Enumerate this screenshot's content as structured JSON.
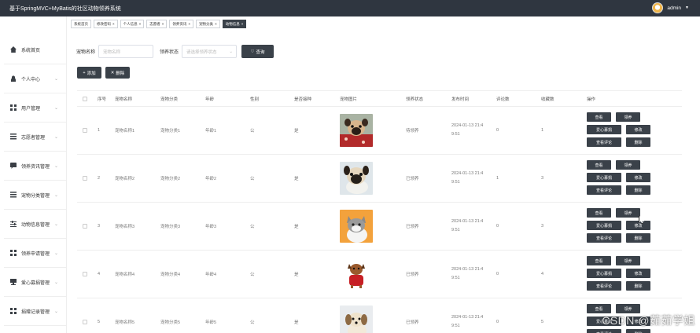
{
  "app": {
    "title": "基于SpringMVC+MyBatis的社区动物领养系统",
    "user": "admin"
  },
  "sidebar": {
    "items": [
      {
        "label": "系统首页",
        "icon": "home-icon",
        "expandable": false
      },
      {
        "label": "个人中心",
        "icon": "user-icon",
        "expandable": true
      },
      {
        "label": "用户管理",
        "icon": "grid-icon",
        "expandable": true
      },
      {
        "label": "志愿者管理",
        "icon": "list-icon",
        "expandable": true
      },
      {
        "label": "领养资讯管理",
        "icon": "message-icon",
        "expandable": true
      },
      {
        "label": "宠物分类管理",
        "icon": "list-icon",
        "expandable": true
      },
      {
        "label": "动物信息管理",
        "icon": "sliders-icon",
        "expandable": true
      },
      {
        "label": "领养申请管理",
        "icon": "grid-icon",
        "expandable": true
      },
      {
        "label": "爱心募捐管理",
        "icon": "monitor-icon",
        "expandable": true
      },
      {
        "label": "捐赠记录管理",
        "icon": "grid-icon",
        "expandable": true
      }
    ]
  },
  "tabs": [
    {
      "label": "系统首页",
      "closable": false,
      "active": false
    },
    {
      "label": "修改密码",
      "closable": true,
      "active": false
    },
    {
      "label": "个人信息",
      "closable": true,
      "active": false
    },
    {
      "label": "志愿者",
      "closable": true,
      "active": false
    },
    {
      "label": "领养资讯",
      "closable": true,
      "active": false
    },
    {
      "label": "宠物分类",
      "closable": true,
      "active": false
    },
    {
      "label": "动物信息",
      "closable": true,
      "active": true
    }
  ],
  "search": {
    "name_label": "宠物名称",
    "name_placeholder": "宠物名称",
    "status_label": "领养状态",
    "status_placeholder": "请选择领养状态",
    "search_button": "查询"
  },
  "toolbar": {
    "add_button": "添加",
    "delete_button": "删除"
  },
  "table": {
    "headers": [
      "序号",
      "宠物名称",
      "宠物分类",
      "年龄",
      "性别",
      "是否接种",
      "宠物图片",
      "领养状态",
      "发布时间",
      "评论数",
      "收藏数",
      "操作"
    ],
    "rows": [
      {
        "index": "1",
        "name": "宠物名称1",
        "category": "宠物分类1",
        "age": "年龄1",
        "gender": "公",
        "vaccinated": "是",
        "status": "待领养",
        "time_line1": "2024-01-13 21:4",
        "time_line2": "9:51",
        "comments": "0",
        "favorites": "1",
        "pet": "pug"
      },
      {
        "index": "2",
        "name": "宠物名称2",
        "category": "宠物分类2",
        "age": "年龄2",
        "gender": "公",
        "vaccinated": "是",
        "status": "已领养",
        "time_line1": "2024-01-13 21:4",
        "time_line2": "9:51",
        "comments": "1",
        "favorites": "3",
        "pet": "pug2"
      },
      {
        "index": "3",
        "name": "宠物名称3",
        "category": "宠物分类3",
        "age": "年龄3",
        "gender": "公",
        "vaccinated": "是",
        "status": "已领养",
        "time_line1": "2024-01-13 21:4",
        "time_line2": "9:51",
        "comments": "0",
        "favorites": "3",
        "pet": "cat"
      },
      {
        "index": "4",
        "name": "宠物名称4",
        "category": "宠物分类4",
        "age": "年龄4",
        "gender": "公",
        "vaccinated": "是",
        "status": "已领养",
        "time_line1": "2024-01-13 21:4",
        "time_line2": "9:51",
        "comments": "0",
        "favorites": "4",
        "pet": "reddog"
      },
      {
        "index": "5",
        "name": "宠物名称5",
        "category": "宠物分类5",
        "age": "年龄5",
        "gender": "公",
        "vaccinated": "是",
        "status": "已领养",
        "time_line1": "2024-01-13 21:4",
        "time_line2": "9:51",
        "comments": "0",
        "favorites": "5",
        "pet": "puppy"
      }
    ],
    "row_buttons": {
      "view": "查看",
      "adopt": "领养",
      "donate": "爱心募捐",
      "edit": "修改",
      "view_comments": "查看评论",
      "delete": "删除"
    }
  },
  "watermark": "CSDN @茹茹学姐",
  "colors": {
    "topbar": "#2f3640",
    "button": "#3a4149",
    "border": "#eeeeee"
  }
}
